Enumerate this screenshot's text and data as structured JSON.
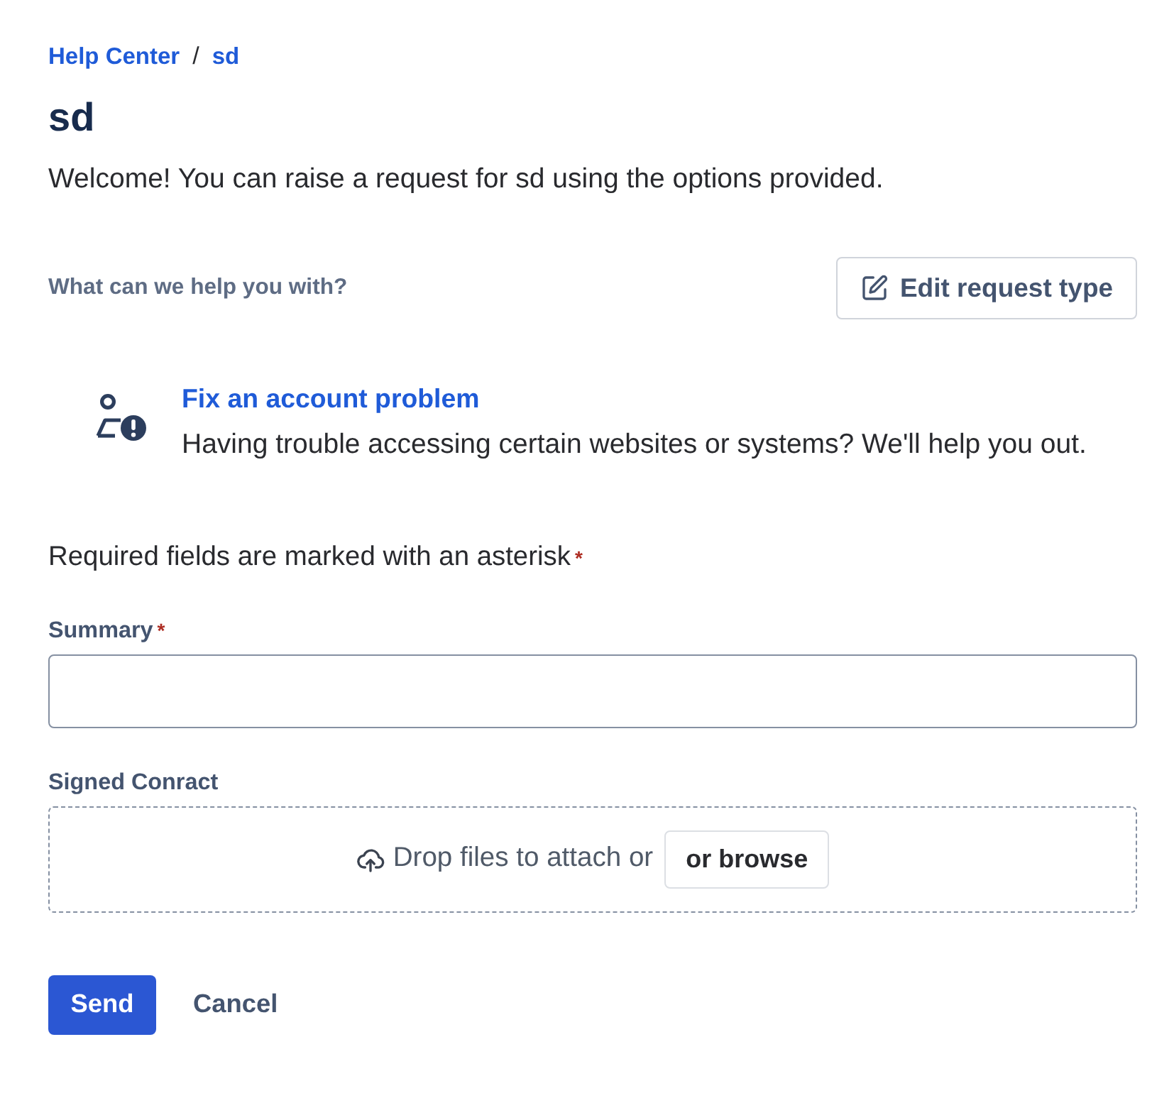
{
  "breadcrumbs": [
    {
      "label": "Help Center"
    },
    {
      "label": "sd"
    }
  ],
  "breadcrumb_separator": "/",
  "title": "sd",
  "welcome": "Welcome! You can raise a request for sd using the options provided.",
  "request_type_section": {
    "label": "What can we help you with?",
    "edit_button": "Edit request type"
  },
  "request_type": {
    "title": "Fix an account problem",
    "description": "Having trouble accessing certain websites or systems? We'll help you out."
  },
  "required_note": {
    "text": "Required fields are marked with an asterisk",
    "marker": "*"
  },
  "fields": [
    {
      "kind": "text",
      "label": "Summary",
      "required_marker": "*"
    },
    {
      "kind": "attachment",
      "label": "Signed Conract",
      "drop_text": "Drop files to attach or",
      "browse_button": "or browse"
    }
  ],
  "buttons": [
    {
      "kind": "primary",
      "label": "Send"
    },
    {
      "kind": "subtle",
      "label": "Cancel"
    }
  ]
}
